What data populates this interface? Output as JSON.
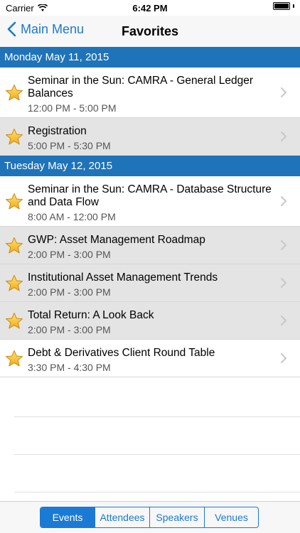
{
  "status_bar": {
    "carrier": "Carrier",
    "time": "6:42 PM"
  },
  "nav": {
    "back_label": "Main Menu",
    "title": "Favorites"
  },
  "sections": [
    {
      "header": "Monday May 11, 2015",
      "rows": [
        {
          "title": "Seminar in the Sun: CAMRA - General Ledger Balances",
          "time": "12:00 PM - 5:00 PM"
        },
        {
          "title": "Registration",
          "time": "5:00 PM - 5:30 PM"
        }
      ]
    },
    {
      "header": "Tuesday May 12, 2015",
      "rows": [
        {
          "title": "Seminar in the Sun: CAMRA - Database Structure and Data Flow",
          "time": "8:00 AM - 12:00 PM"
        },
        {
          "title": "GWP: Asset Management Roadmap",
          "time": "2:00 PM - 3:00 PM"
        },
        {
          "title": "Institutional Asset Management Trends",
          "time": "2:00 PM - 3:00 PM"
        },
        {
          "title": "Total Return: A Look Back",
          "time": "2:00 PM - 3:00 PM"
        },
        {
          "title": "Debt & Derivatives Client Round Table",
          "time": "3:30 PM - 4:30 PM"
        }
      ]
    }
  ],
  "tabs": [
    {
      "label": "Events",
      "selected": true
    },
    {
      "label": "Attendees",
      "selected": false
    },
    {
      "label": "Speakers",
      "selected": false
    },
    {
      "label": "Venues",
      "selected": false
    }
  ],
  "icons": {
    "row_icon": "star-icon",
    "row_accessory": "chevron-right-icon",
    "back": "chevron-left-icon"
  },
  "colors": {
    "accent": "#1a7ad4",
    "section_header": "#1f73b8",
    "star": "#f6c12a",
    "row_highlight": "#e4e4e4"
  }
}
